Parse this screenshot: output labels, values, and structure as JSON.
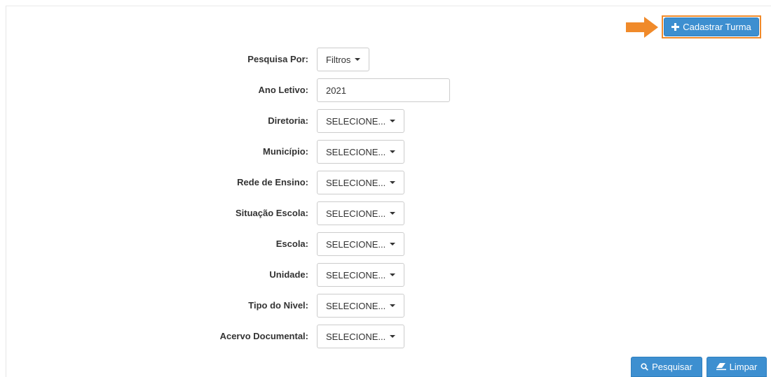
{
  "toolbar": {
    "cadastrar_label": "Cadastrar Turma"
  },
  "filters": {
    "pesquisa_por": {
      "label": "Pesquisa Por:",
      "value": "Filtros"
    },
    "ano_letivo": {
      "label": "Ano Letivo:",
      "value": "2021"
    },
    "diretoria": {
      "label": "Diretoria:",
      "value": "SELECIONE..."
    },
    "municipio": {
      "label": "Município:",
      "value": "SELECIONE..."
    },
    "rede_ensino": {
      "label": "Rede de Ensino:",
      "value": "SELECIONE..."
    },
    "situacao_escola": {
      "label": "Situação Escola:",
      "value": "SELECIONE..."
    },
    "escola": {
      "label": "Escola:",
      "value": "SELECIONE..."
    },
    "unidade": {
      "label": "Unidade:",
      "value": "SELECIONE..."
    },
    "tipo_nivel": {
      "label": "Tipo do Nivel:",
      "value": "SELECIONE..."
    },
    "acervo_documental": {
      "label": "Acervo Documental:",
      "value": "SELECIONE..."
    }
  },
  "actions": {
    "pesquisar_label": "Pesquisar",
    "limpar_label": "Limpar"
  },
  "colors": {
    "primary": "#3d8fd0",
    "highlight": "#f08a2a"
  },
  "icons": {
    "arrow": "right-arrow-icon",
    "plus": "plus-icon",
    "search": "search-icon",
    "eraser": "eraser-icon"
  }
}
